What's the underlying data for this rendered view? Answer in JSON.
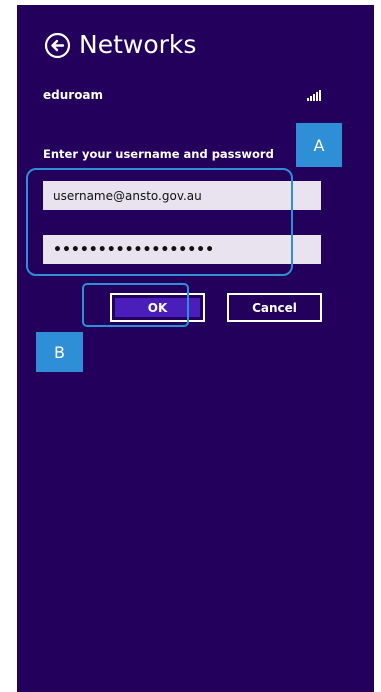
{
  "header": {
    "title": "Networks",
    "back_icon": "back-arrow-circle-icon"
  },
  "network": {
    "name": "eduroam",
    "signal_icon": "wifi-signal-icon"
  },
  "form": {
    "prompt": "Enter your username and password",
    "username_value": "username@ansto.gov.au",
    "password_value": "••••••••••••••••••"
  },
  "buttons": {
    "ok_label": "OK",
    "cancel_label": "Cancel"
  },
  "callouts": {
    "a_label": "A",
    "b_label": "B"
  },
  "colors": {
    "background": "#22005c",
    "accent": "#4a1eba",
    "callout": "#2f8fd6"
  }
}
